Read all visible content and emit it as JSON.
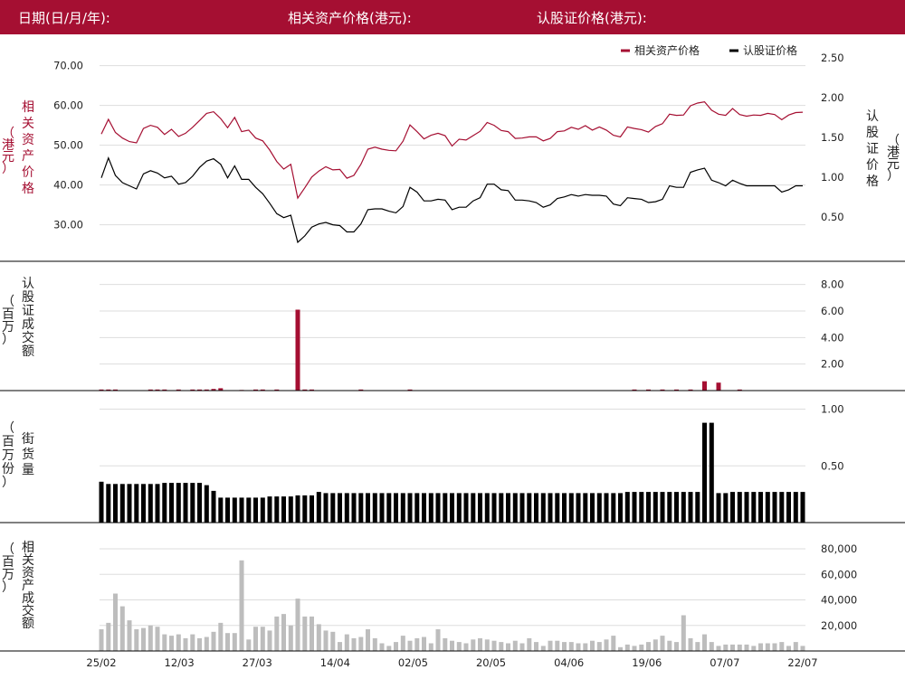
{
  "header": {
    "date_label": "日期(日/月/年):",
    "asset_price_label": "相关资产价格(港元):",
    "warrant_price_label": "认股证价格(港元):"
  },
  "colors": {
    "header_bg": "#a50f32",
    "asset": "#a50f32",
    "warrant": "#000000",
    "volume": "#bdbdbd",
    "grid": "#dddddd"
  },
  "chart_data": [
    {
      "type": "line",
      "legend": [
        {
          "name": "相关资产价格",
          "color": "#a50f32"
        },
        {
          "name": "认股证价格",
          "color": "#000000"
        }
      ],
      "y_left": {
        "label": "相关资产价格（港元）",
        "ticks": [
          "30.00",
          "40.00",
          "50.00",
          "60.00",
          "70.00"
        ],
        "ylim": [
          24,
          74
        ]
      },
      "y_right": {
        "label": "认股证价格（港元）",
        "ticks": [
          "0.50",
          "1.00",
          "1.50",
          "2.00",
          "2.50"
        ],
        "ylim": [
          0.1,
          2.6
        ]
      },
      "series": [
        {
          "name": "相关资产价格",
          "axis": "left",
          "values": [
            52.8,
            56.5,
            53.2,
            51.8,
            50.9,
            50.6,
            54.2,
            55.0,
            54.5,
            52.7,
            54.0,
            52.2,
            53.0,
            54.5,
            56.2,
            58.0,
            58.4,
            56.7,
            54.4,
            57.0,
            53.4,
            53.8,
            51.8,
            51.1,
            48.8,
            45.9,
            44.0,
            45.2,
            36.7,
            39.3,
            42.0,
            43.5,
            44.6,
            43.8,
            43.9,
            41.7,
            42.4,
            45.2,
            49.0,
            49.5,
            49.0,
            48.7,
            48.6,
            51.0,
            55.1,
            53.4,
            51.6,
            52.5,
            53.0,
            52.4,
            49.8,
            51.5,
            51.3,
            52.4,
            53.5,
            55.7,
            55.0,
            53.7,
            53.4,
            51.7,
            51.8,
            52.1,
            52.1,
            51.1,
            51.7,
            53.4,
            53.6,
            54.5,
            54.0,
            54.9,
            53.8,
            54.6,
            53.8,
            52.5,
            52.1,
            54.6,
            54.2,
            53.9,
            53.3,
            54.7,
            55.4,
            57.8,
            57.5,
            57.6,
            59.9,
            60.6,
            60.9,
            58.8,
            57.8,
            57.5,
            59.2,
            57.7,
            57.3,
            57.6,
            57.5,
            58.0,
            57.7,
            56.4,
            57.6,
            58.2,
            58.3
          ]
        },
        {
          "name": "认股证价格",
          "axis": "right",
          "values": [
            0.99,
            1.24,
            1.02,
            0.93,
            0.89,
            0.85,
            1.04,
            1.08,
            1.05,
            0.99,
            1.01,
            0.91,
            0.93,
            1.01,
            1.12,
            1.2,
            1.23,
            1.16,
            0.99,
            1.14,
            0.97,
            0.97,
            0.87,
            0.79,
            0.67,
            0.54,
            0.49,
            0.52,
            0.18,
            0.26,
            0.37,
            0.41,
            0.43,
            0.4,
            0.39,
            0.31,
            0.31,
            0.41,
            0.59,
            0.6,
            0.6,
            0.57,
            0.55,
            0.63,
            0.87,
            0.81,
            0.7,
            0.7,
            0.72,
            0.71,
            0.59,
            0.62,
            0.62,
            0.7,
            0.74,
            0.91,
            0.91,
            0.84,
            0.83,
            0.71,
            0.71,
            0.7,
            0.68,
            0.62,
            0.65,
            0.73,
            0.75,
            0.78,
            0.76,
            0.78,
            0.77,
            0.77,
            0.76,
            0.66,
            0.64,
            0.74,
            0.73,
            0.72,
            0.68,
            0.69,
            0.72,
            0.89,
            0.87,
            0.87,
            1.06,
            1.09,
            1.11,
            0.96,
            0.93,
            0.89,
            0.96,
            0.92,
            0.89,
            0.89,
            0.89,
            0.89,
            0.89,
            0.81,
            0.84,
            0.89,
            0.89
          ]
        }
      ]
    },
    {
      "type": "bar",
      "y": {
        "label": "认股证成交额（百万）",
        "ticks": [
          "2.00",
          "4.00",
          "6.00",
          "8.00"
        ],
        "ylim": [
          0,
          9
        ]
      },
      "series": [
        {
          "name": "认股证成交额",
          "values": [
            0.08,
            0.08,
            0.08,
            0,
            0,
            0,
            0,
            0.08,
            0.08,
            0.08,
            0,
            0.08,
            0,
            0.08,
            0.08,
            0.08,
            0.12,
            0.18,
            0,
            0,
            0.05,
            0,
            0.08,
            0.08,
            0,
            0.08,
            0,
            0,
            6.1,
            0.08,
            0.08,
            0,
            0,
            0,
            0,
            0,
            0,
            0.08,
            0,
            0,
            0,
            0,
            0,
            0,
            0.08,
            0,
            0,
            0,
            0,
            0,
            0,
            0,
            0,
            0,
            0,
            0,
            0,
            0,
            0,
            0,
            0,
            0,
            0,
            0,
            0,
            0,
            0,
            0,
            0,
            0,
            0,
            0,
            0,
            0,
            0,
            0,
            0.08,
            0,
            0.08,
            0,
            0.08,
            0,
            0.08,
            0,
            0.08,
            0,
            0.7,
            0,
            0.6,
            0,
            0,
            0.08,
            0,
            0,
            0,
            0,
            0,
            0,
            0,
            0,
            0
          ]
        }
      ]
    },
    {
      "type": "bar",
      "y": {
        "label": "街货量（百万份）",
        "ticks": [
          "0.50",
          "1.00"
        ],
        "ylim": [
          0,
          1.1
        ]
      },
      "series": [
        {
          "name": "街货量",
          "values": [
            0.36,
            0.34,
            0.34,
            0.34,
            0.34,
            0.34,
            0.34,
            0.34,
            0.34,
            0.35,
            0.35,
            0.35,
            0.35,
            0.35,
            0.35,
            0.33,
            0.28,
            0.22,
            0.22,
            0.22,
            0.22,
            0.22,
            0.22,
            0.22,
            0.23,
            0.23,
            0.23,
            0.23,
            0.24,
            0.24,
            0.24,
            0.27,
            0.26,
            0.26,
            0.26,
            0.26,
            0.26,
            0.26,
            0.26,
            0.26,
            0.26,
            0.26,
            0.26,
            0.26,
            0.26,
            0.26,
            0.26,
            0.26,
            0.26,
            0.26,
            0.26,
            0.26,
            0.26,
            0.26,
            0.26,
            0.26,
            0.26,
            0.26,
            0.26,
            0.26,
            0.26,
            0.26,
            0.26,
            0.26,
            0.26,
            0.26,
            0.26,
            0.26,
            0.26,
            0.26,
            0.26,
            0.26,
            0.26,
            0.26,
            0.26,
            0.27,
            0.27,
            0.27,
            0.27,
            0.27,
            0.27,
            0.27,
            0.27,
            0.27,
            0.27,
            0.27,
            0.88,
            0.88,
            0.26,
            0.26,
            0.27,
            0.27,
            0.27,
            0.27,
            0.27,
            0.27,
            0.27,
            0.27,
            0.27,
            0.27,
            0.27
          ]
        }
      ]
    },
    {
      "type": "bar",
      "y": {
        "label": "相关资产成交额（百万）",
        "ticks": [
          "20,000",
          "40,000",
          "60,000",
          "80,000"
        ],
        "ylim": [
          0,
          85000
        ]
      },
      "x": {
        "tick_labels": [
          "25/02",
          "12/03",
          "27/03",
          "14/04",
          "02/05",
          "20/05",
          "04/06",
          "19/06",
          "07/07",
          "22/07"
        ]
      },
      "series": [
        {
          "name": "相关资产成交额",
          "values": [
            17000,
            22000,
            45000,
            35000,
            24000,
            17000,
            18000,
            20000,
            19000,
            13000,
            12000,
            13000,
            10000,
            13000,
            10000,
            11000,
            15000,
            22000,
            14000,
            14000,
            71000,
            9000,
            19000,
            19000,
            16000,
            27000,
            29000,
            20000,
            41000,
            27000,
            27000,
            21000,
            16000,
            15000,
            7000,
            13000,
            10000,
            11000,
            17000,
            10000,
            6000,
            4000,
            7000,
            12000,
            8000,
            10000,
            11000,
            6000,
            17000,
            10000,
            8000,
            7000,
            6000,
            9000,
            10000,
            9000,
            8000,
            7000,
            6000,
            8000,
            6000,
            10000,
            7000,
            4000,
            8000,
            8000,
            7000,
            7000,
            6000,
            6000,
            8000,
            7000,
            9000,
            12000,
            3000,
            5000,
            4000,
            5000,
            7000,
            9000,
            12000,
            8000,
            7000,
            28000,
            10000,
            7000,
            13000,
            7000,
            4000,
            5000,
            5000,
            5000,
            5000,
            4000,
            6000,
            6000,
            6000,
            7000,
            4000,
            7000,
            4000
          ]
        }
      ]
    }
  ]
}
